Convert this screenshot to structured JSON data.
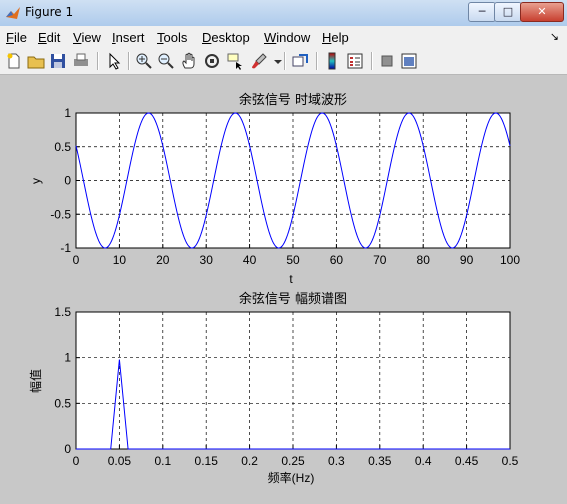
{
  "window": {
    "title": "Figure 1",
    "min_label": "─",
    "max_label": "□",
    "close_label": "✕"
  },
  "menu": {
    "items": [
      {
        "label": "File",
        "ul": "F",
        "rest": "ile"
      },
      {
        "label": "Edit",
        "ul": "E",
        "rest": "dit"
      },
      {
        "label": "View",
        "ul": "V",
        "rest": "iew"
      },
      {
        "label": "Insert",
        "ul": "I",
        "rest": "nsert"
      },
      {
        "label": "Tools",
        "ul": "T",
        "rest": "ools"
      },
      {
        "label": "Desktop",
        "ul": "D",
        "rest": "esktop"
      },
      {
        "label": "Window",
        "ul": "W",
        "rest": "indow"
      },
      {
        "label": "Help",
        "ul": "H",
        "rest": "elp"
      }
    ],
    "overflow": "↘"
  },
  "toolbar": {
    "icons": [
      "new-figure-icon",
      "open-file-icon",
      "save-icon",
      "print-icon",
      "edit-plot-icon",
      "zoom-in-icon",
      "zoom-out-icon",
      "pan-icon",
      "rotate-3d-icon",
      "data-cursor-icon",
      "brush-icon",
      "brush-dropdown-icon",
      "link-plot-icon",
      "insert-colorbar-icon",
      "insert-legend-icon",
      "hide-plot-tools-icon",
      "show-plot-tools-icon"
    ]
  },
  "chart_data": [
    {
      "type": "line",
      "title": "余弦信号 时域波形",
      "xlabel": "t",
      "ylabel": "y",
      "xlim": [
        0,
        100
      ],
      "ylim": [
        -1,
        1
      ],
      "xticks": [
        "0",
        "10",
        "20",
        "30",
        "40",
        "50",
        "60",
        "70",
        "80",
        "90",
        "100"
      ],
      "yticks": [
        "1",
        "0.5",
        "0",
        "-0.5",
        "-1"
      ],
      "grid": true,
      "series": [
        {
          "function": "cos(2*pi*0.05*t + 1.03)",
          "color": "#0000ff"
        }
      ]
    },
    {
      "type": "line",
      "title": "余弦信号 幅频谱图",
      "xlabel": "频率(Hz)",
      "ylabel": "幅值",
      "xlim": [
        0,
        0.5
      ],
      "ylim": [
        0,
        1.5
      ],
      "xticks": [
        "0",
        "0.05",
        "0.1",
        "0.15",
        "0.2",
        "0.25",
        "0.3",
        "0.35",
        "0.4",
        "0.45",
        "0.5"
      ],
      "yticks": [
        "1.5",
        "1",
        "0.5",
        "0"
      ],
      "grid": true,
      "series": [
        {
          "x": [
            0,
            0.04,
            0.05,
            0.06,
            0.5
          ],
          "y": [
            0,
            0,
            0.98,
            0,
            0
          ],
          "color": "#0000ff"
        }
      ]
    }
  ]
}
